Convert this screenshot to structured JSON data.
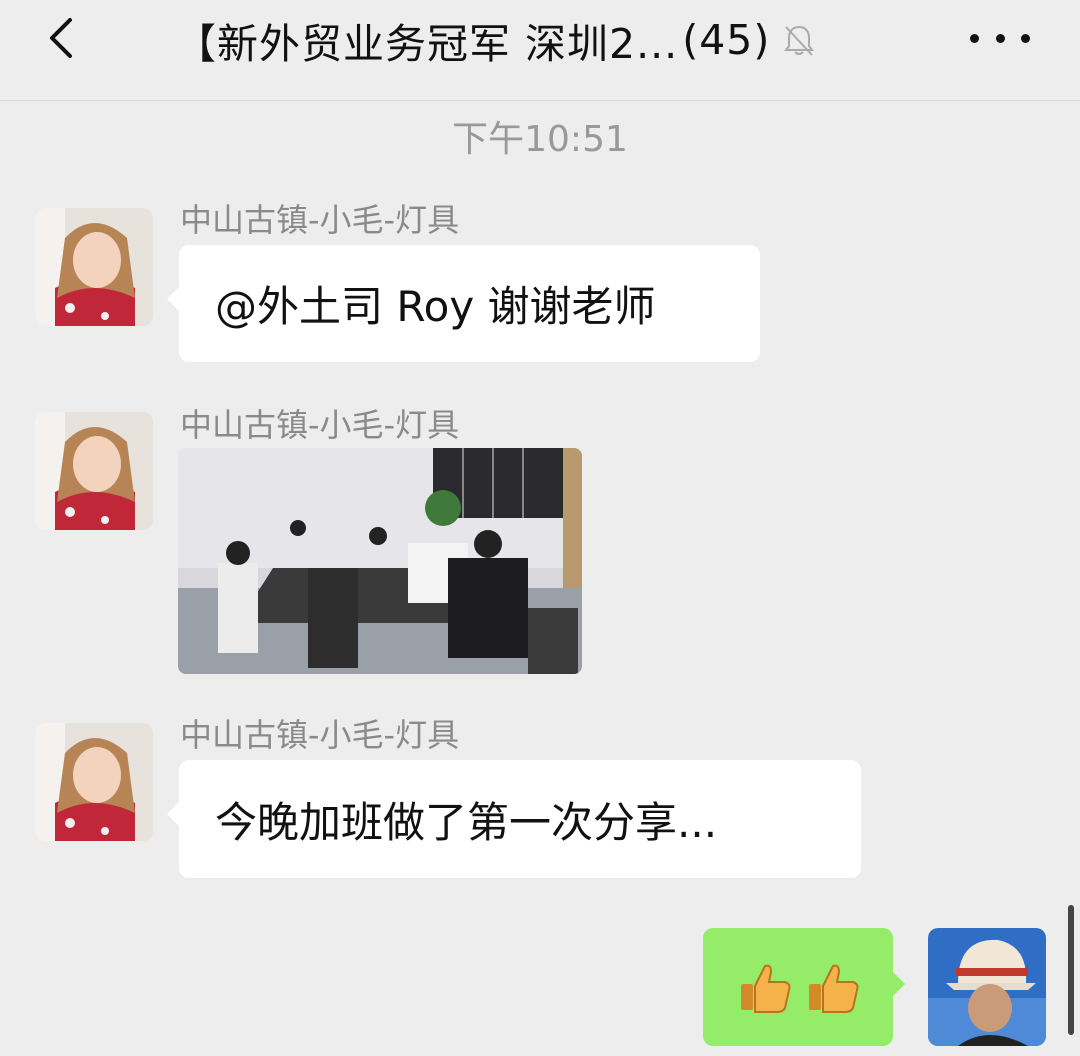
{
  "header": {
    "title": "【新外贸业务冠军 深圳2...",
    "member_count": "(45)",
    "back_icon": "chevron-left-icon",
    "mute_icon": "bell-slash-icon",
    "more_icon": "ellipsis-icon"
  },
  "timestamp": "下午10:51",
  "messages": [
    {
      "sender": "中山古镇-小毛-灯具",
      "type": "text",
      "text": "@外土司 Roy 谢谢老师"
    },
    {
      "sender": "中山古镇-小毛-灯具",
      "type": "image"
    },
    {
      "sender": "中山古镇-小毛-灯具",
      "type": "text",
      "text": "今晚加班做了第一次分享..."
    }
  ],
  "my_message": {
    "type": "emoji",
    "emoji": [
      "👍",
      "👍"
    ]
  },
  "colors": {
    "background": "#ededed",
    "bubble_incoming": "#ffffff",
    "bubble_outgoing": "#95ec69",
    "sender_name": "#8a8a8a"
  }
}
